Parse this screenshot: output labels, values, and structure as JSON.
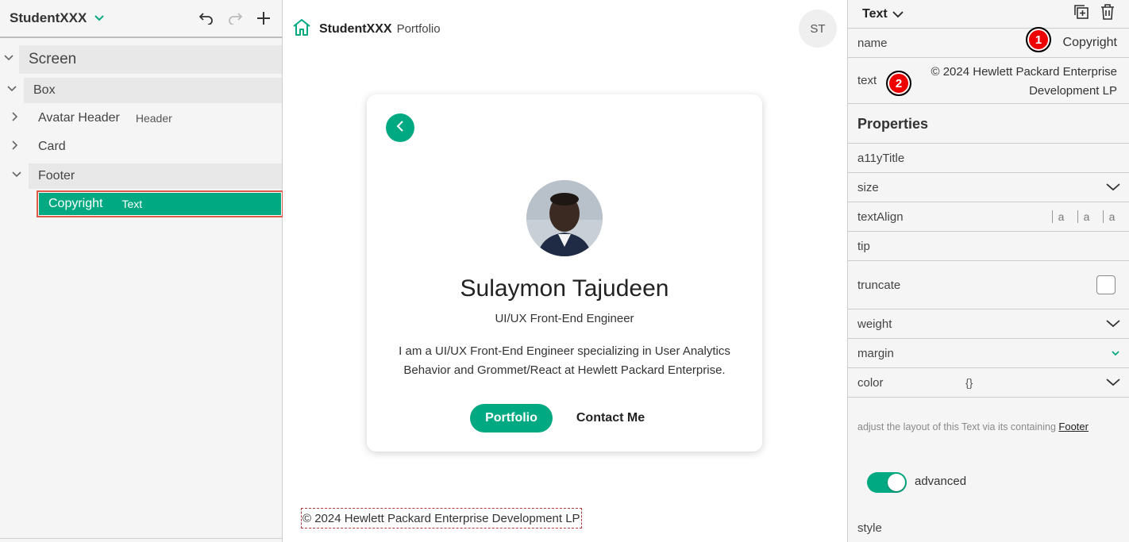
{
  "left_panel": {
    "app_title": "StudentXXX",
    "tree": {
      "screen": "Screen",
      "box": "Box",
      "avatar_header": {
        "label": "Avatar Header",
        "type": "Header"
      },
      "card": "Card",
      "footer": "Footer",
      "copyright": {
        "label": "Copyright",
        "type": "Text"
      }
    }
  },
  "canvas": {
    "brand_name": "StudentXXX",
    "brand_sub": "Portfolio",
    "avatar_initials": "ST",
    "card": {
      "name": "Sulaymon Tajudeen",
      "role": "UI/UX Front-End Engineer",
      "bio": "I am a UI/UX Front-End Engineer specializing in User Analytics Behavior and Grommet/React at Hewlett Packard Enterprise.",
      "primary_button": "Portfolio",
      "secondary_button": "Contact Me"
    },
    "footer_text": "© 2024 Hewlett Packard Enterprise Development LP"
  },
  "right_panel": {
    "component_type": "Text",
    "name_label": "name",
    "name_value": "Copyright",
    "text_label": "text",
    "text_value": "© 2024 Hewlett Packard Enterprise Development LP",
    "badges": [
      "1",
      "2"
    ],
    "properties_title": "Properties",
    "props": {
      "a11y": "a11yTitle",
      "size": "size",
      "text_align": "textAlign",
      "align_options": [
        "a",
        "a",
        "a"
      ],
      "tip": "tip",
      "truncate": "truncate",
      "weight": "weight",
      "margin": "margin",
      "color": "color",
      "color_value": "{}"
    },
    "layout_note": "adjust the layout of this Text via its containing",
    "layout_link": "Footer",
    "advanced_label": "advanced",
    "advanced_on": true,
    "style_label": "style"
  },
  "colors": {
    "brand": "#01a982",
    "selection_border": "#e05a4a",
    "badge": "#ee0000"
  }
}
